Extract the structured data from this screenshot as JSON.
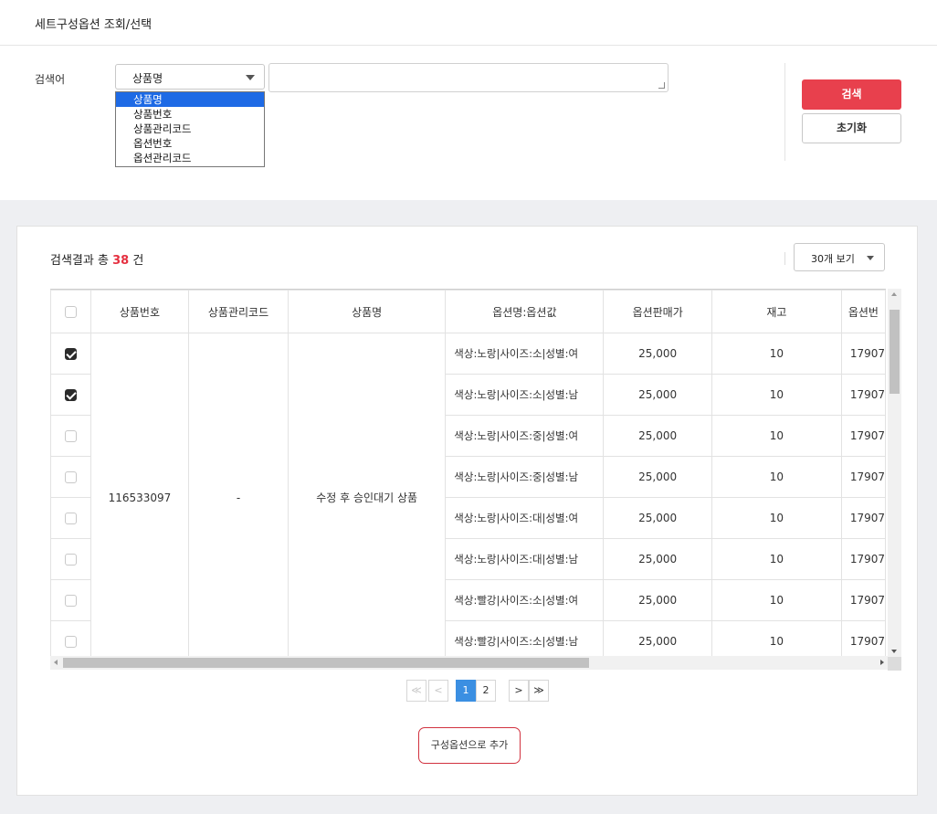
{
  "page": {
    "title": "세트구성옵션 조회/선택"
  },
  "search": {
    "label": "검색어",
    "select_value": "상품명",
    "options": [
      "상품명",
      "상품번호",
      "상품관리코드",
      "옵션번호",
      "옵션관리코드"
    ],
    "text_value": "",
    "search_button": "검색",
    "reset_button": "초기화"
  },
  "results": {
    "prefix": "검색결과 총",
    "count": "38",
    "suffix": "건",
    "page_size": "30개 보기"
  },
  "table": {
    "headers": [
      "상품번호",
      "상품관리코드",
      "상품명",
      "옵션명:옵션값",
      "옵션판매가",
      "재고",
      "옵션번"
    ],
    "group": {
      "product_no": "116533097",
      "mgmt_code": "-",
      "product_name": "수정 후 승인대기 상품"
    },
    "rows": [
      {
        "checked": true,
        "option": "색상:노랑|사이즈:소|성별:여",
        "price": "25,000",
        "stock": "10",
        "option_no": "17907"
      },
      {
        "checked": true,
        "option": "색상:노랑|사이즈:소|성별:남",
        "price": "25,000",
        "stock": "10",
        "option_no": "17907"
      },
      {
        "checked": false,
        "option": "색상:노랑|사이즈:중|성별:여",
        "price": "25,000",
        "stock": "10",
        "option_no": "17907"
      },
      {
        "checked": false,
        "option": "색상:노랑|사이즈:중|성별:남",
        "price": "25,000",
        "stock": "10",
        "option_no": "17907"
      },
      {
        "checked": false,
        "option": "색상:노랑|사이즈:대|성별:여",
        "price": "25,000",
        "stock": "10",
        "option_no": "17907"
      },
      {
        "checked": false,
        "option": "색상:노랑|사이즈:대|성별:남",
        "price": "25,000",
        "stock": "10",
        "option_no": "17907"
      },
      {
        "checked": false,
        "option": "색상:빨강|사이즈:소|성별:여",
        "price": "25,000",
        "stock": "10",
        "option_no": "17907"
      },
      {
        "checked": false,
        "option": "색상:빨강|사이즈:소|성별:남",
        "price": "25,000",
        "stock": "10",
        "option_no": "17907"
      }
    ]
  },
  "pagination": {
    "first": "≪",
    "prev": "<",
    "pages": [
      "1",
      "2"
    ],
    "current": "1",
    "next": ">",
    "last": "≫"
  },
  "actions": {
    "add_button": "구성옵션으로 추가"
  },
  "colors": {
    "accent_red": "#e8404d",
    "count_red": "#e53040",
    "page_active": "#3b8fe2",
    "dropdown_highlight": "#1e6ae5"
  }
}
